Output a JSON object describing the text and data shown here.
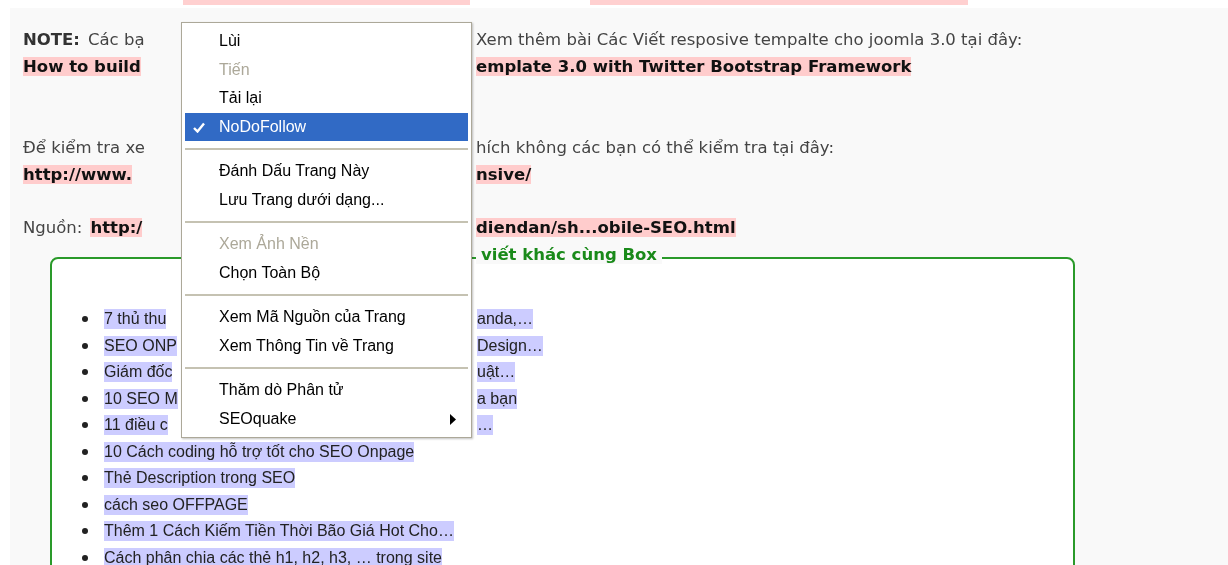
{
  "paragraphs": [
    {
      "lines": [
        {
          "left": [
            {
              "text": "NOTE:",
              "kind": "bold"
            },
            {
              "text": "Các bạ",
              "kind": "plain"
            }
          ],
          "right": [
            {
              "text": "Xem thêm bài Các Viết resposive tempalte cho joomla 3.0 tại đây:",
              "kind": "plain"
            }
          ]
        },
        {
          "left": [
            {
              "text": "How to build",
              "kind": "link"
            }
          ],
          "right": [
            {
              "text": "emplate 3.0 with Twitter Bootstrap Framework",
              "kind": "link"
            }
          ]
        }
      ]
    },
    {
      "lines": [
        {
          "left": [
            {
              "text": "Để kiểm tra xe",
              "kind": "plain"
            }
          ],
          "right": [
            {
              "text": "hích không các bạn có thể kiểm tra tại đây:",
              "kind": "plain"
            }
          ]
        },
        {
          "left": [
            {
              "text": "http://www.",
              "kind": "link"
            }
          ],
          "right": [
            {
              "text": "nsive/",
              "kind": "link"
            }
          ]
        }
      ]
    },
    {
      "lines": [
        {
          "left": [
            {
              "text": "Nguồn:",
              "kind": "plain"
            },
            {
              "text": "http:/",
              "kind": "link"
            }
          ],
          "right": [
            {
              "text": "diendan/sh...obile-SEO.html",
              "kind": "link"
            }
          ]
        }
      ]
    }
  ],
  "related_box": {
    "legend": "viết khác cùng Box",
    "items": [
      {
        "left": "7 thủ thu",
        "right": "anda,…"
      },
      {
        "left": "SEO ONP",
        "right": "Design…"
      },
      {
        "left": "Giám đốc",
        "right": "uật…"
      },
      {
        "left": "10 SEO M",
        "right": "a bạn"
      },
      {
        "left": "11 điều c",
        "right": "…"
      },
      {
        "left": "10 Cách coding hỗ trợ tốt cho SEO Onpage"
      },
      {
        "left": "Thẻ Description trong SEO"
      },
      {
        "left": "cách seo OFFPAGE"
      },
      {
        "left": "Thêm 1 Cách Kiếm Tiền Thời Bão Giá Hot Cho…"
      },
      {
        "left": "Cách phân chia các thẻ h1, h2, h3, … trong site"
      }
    ]
  },
  "context_menu": {
    "items": [
      {
        "kind": "item",
        "label": "Lùi",
        "disabled": false,
        "checked": false,
        "selected": false,
        "submenu": false
      },
      {
        "kind": "item",
        "label": "Tiến",
        "disabled": true,
        "checked": false,
        "selected": false,
        "submenu": false
      },
      {
        "kind": "item",
        "label": "Tải lại",
        "disabled": false,
        "checked": false,
        "selected": false,
        "submenu": false
      },
      {
        "kind": "item",
        "label": "NoDoFollow",
        "disabled": false,
        "checked": true,
        "selected": true,
        "submenu": false
      },
      {
        "kind": "separator"
      },
      {
        "kind": "item",
        "label": "Đánh Dấu Trang Này",
        "disabled": false,
        "checked": false,
        "selected": false,
        "submenu": false
      },
      {
        "kind": "item",
        "label": "Lưu Trang dưới dạng...",
        "disabled": false,
        "checked": false,
        "selected": false,
        "submenu": false
      },
      {
        "kind": "separator"
      },
      {
        "kind": "item",
        "label": "Xem Ảnh Nền",
        "disabled": true,
        "checked": false,
        "selected": false,
        "submenu": false
      },
      {
        "kind": "item",
        "label": "Chọn Toàn Bộ",
        "disabled": false,
        "checked": false,
        "selected": false,
        "submenu": false
      },
      {
        "kind": "separator"
      },
      {
        "kind": "item",
        "label": "Xem Mã Nguồn của Trang",
        "disabled": false,
        "checked": false,
        "selected": false,
        "submenu": false
      },
      {
        "kind": "item",
        "label": "Xem Thông Tin về Trang",
        "disabled": false,
        "checked": false,
        "selected": false,
        "submenu": false
      },
      {
        "kind": "separator"
      },
      {
        "kind": "item",
        "label": "Thăm dò Phân tử",
        "disabled": false,
        "checked": false,
        "selected": false,
        "submenu": false
      },
      {
        "kind": "item",
        "label": "SEOquake",
        "disabled": false,
        "checked": false,
        "selected": false,
        "submenu": true
      }
    ]
  }
}
